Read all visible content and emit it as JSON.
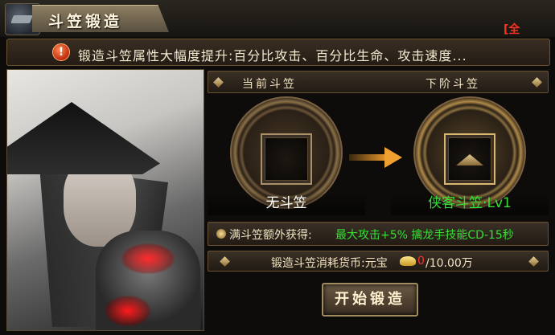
{
  "window": {
    "title": "斗笠锻造",
    "corner_tag": "[全",
    "icon": "warrior-portrait-icon"
  },
  "notice": {
    "icon": "warning-icon",
    "text": "锻造斗笠属性大幅度提升:百分比攻击、百分比生命、攻击速度..."
  },
  "forge": {
    "current_header": "当前斗笠",
    "next_header": "下阶斗笠",
    "current_item_name": "无斗笠",
    "next_item_name": "侠客斗笠·Lv1",
    "bonus_label": "满斗笠额外获得:",
    "bonus_value": "最大攻击+5%  擒龙手技能CD-15秒",
    "cost_label": "锻造斗笠消耗货币:元宝",
    "cost_current": "0",
    "cost_max": "/10.00万",
    "forge_button": "开始锻造"
  },
  "colors": {
    "accent_green": "#34e034",
    "accent_red": "#ff3030",
    "border_gold": "#6a5232"
  }
}
